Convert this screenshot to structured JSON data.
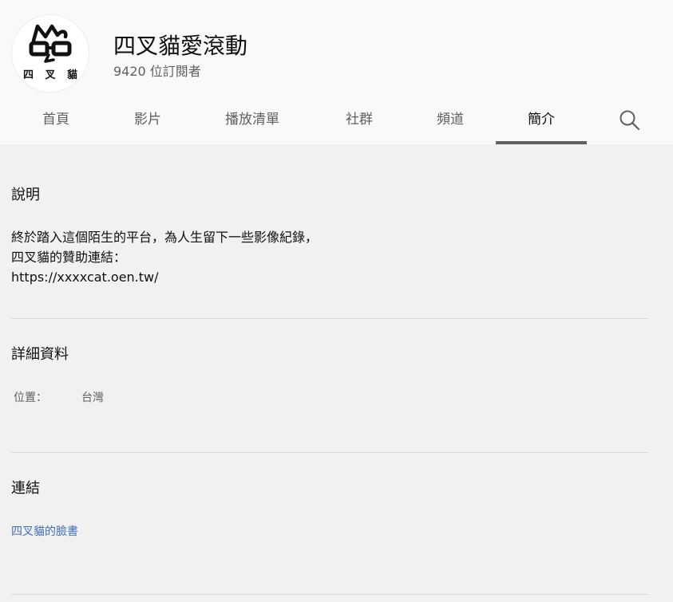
{
  "channel": {
    "avatar_text": "四 叉 貓",
    "name": "四叉貓愛滾動",
    "subscribers": "9420 位訂閱者"
  },
  "tabs": [
    {
      "label": "首頁",
      "active": false
    },
    {
      "label": "影片",
      "active": false
    },
    {
      "label": "播放清單",
      "active": false
    },
    {
      "label": "社群",
      "active": false
    },
    {
      "label": "頻道",
      "active": false
    },
    {
      "label": "簡介",
      "active": true
    }
  ],
  "search": {
    "icon": "search-icon"
  },
  "about": {
    "description_title": "說明",
    "description_lines": [
      "終於踏入這個陌生的平台，為人生留下一些影像紀錄，",
      "四叉貓的贊助連結：",
      "https://xxxxcat.oen.tw/"
    ],
    "details_title": "詳細資料",
    "location_label": "位置：",
    "location_value": "台灣",
    "links_title": "連結",
    "links": [
      {
        "label": "四叉貓的臉書"
      }
    ]
  },
  "colors": {
    "header_bg": "#f9f9f9",
    "page_bg": "#f1f1f1",
    "secondary_text": "#606060",
    "link": "#3e6fb8",
    "active_tab_underline": "#606060"
  }
}
